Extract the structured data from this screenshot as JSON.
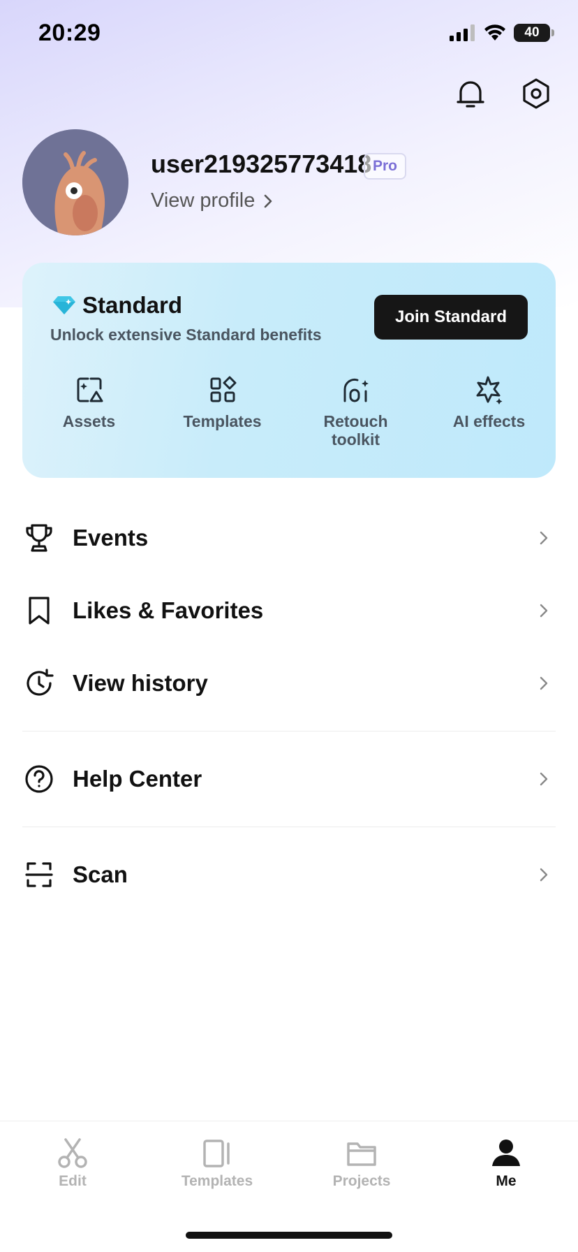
{
  "status_bar": {
    "time": "20:29",
    "battery": "40",
    "icons": [
      "signal-icon",
      "wifi-icon",
      "battery-icon"
    ]
  },
  "header": {
    "icons": [
      "bell-icon",
      "settings-icon"
    ]
  },
  "profile": {
    "username": "user219325773418",
    "badge": "Pro",
    "view_profile": "View profile"
  },
  "standard_card": {
    "title": "Standard",
    "subtitle": "Unlock extensive Standard benefits",
    "button": "Join Standard",
    "benefits": [
      {
        "label": "Assets",
        "icon": "assets-icon"
      },
      {
        "label": "Templates",
        "icon": "templates-icon"
      },
      {
        "label": "Retouch toolkit",
        "icon": "retouch-icon"
      },
      {
        "label": "AI effects",
        "icon": "ai-effects-icon"
      }
    ]
  },
  "menu": {
    "items": [
      {
        "label": "Events",
        "icon": "trophy-icon"
      },
      {
        "label": "Likes & Favorites",
        "icon": "bookmark-icon"
      },
      {
        "label": "View history",
        "icon": "history-icon"
      },
      {
        "label": "Help Center",
        "icon": "help-icon"
      },
      {
        "label": "Scan",
        "icon": "scan-icon"
      }
    ]
  },
  "tab_bar": {
    "tabs": [
      {
        "label": "Edit",
        "icon": "scissors-icon",
        "active": false
      },
      {
        "label": "Templates",
        "icon": "templates-tab-icon",
        "active": false
      },
      {
        "label": "Projects",
        "icon": "folder-icon",
        "active": false
      },
      {
        "label": "Me",
        "icon": "person-icon",
        "active": true
      }
    ]
  },
  "colors": {
    "accent": "#7b6fd6",
    "card_bg": "#c8ecfa",
    "button_bg": "#161616",
    "diamond": "#3fc6e6"
  }
}
